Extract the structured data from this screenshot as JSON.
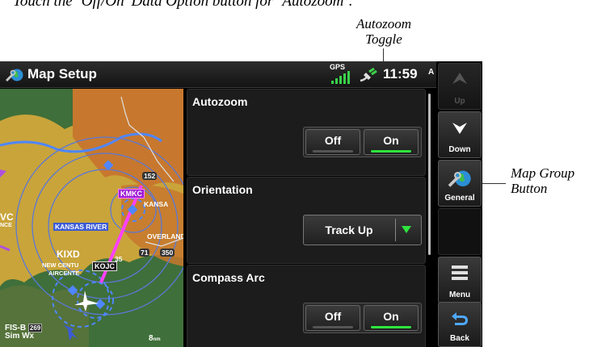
{
  "document": {
    "instruction": "Touch the ‘Off/On’ Data Option button for ‘Autozoom’.",
    "callouts": {
      "autozoom_toggle": [
        "Autozoom",
        "Toggle"
      ],
      "map_group_button": [
        "Map Group",
        "Button"
      ]
    }
  },
  "window": {
    "title": "Map Setup",
    "title_icon": "map-globe-wrench-icon",
    "gps_label": "GPS",
    "time": "11:59",
    "time_suffix": "A"
  },
  "map": {
    "airports": {
      "kmkc": "KMKC",
      "kixd": "KIXD",
      "kojc": "KOJC"
    },
    "labels": {
      "kansas_city": "KANSA",
      "kansas_river": "KANSAS RIVER",
      "overland": "OVERLAND",
      "new_century": "NEW CENTU",
      "aircenter": "AIRCENTE",
      "partial_vc": "VC",
      "partial_nce": "NCE",
      "hwy_152": "152",
      "hwy_71": "71",
      "hwy_350": "350",
      "hwy_35": "35"
    },
    "fisb_line1": "FIS-B",
    "fisb_count": "269",
    "fisb_line2": "Sim Wx",
    "range": "8",
    "range_unit": "nm",
    "colors": {
      "terrain_yellow": "#c9a43a",
      "terrain_orange": "#c7782e",
      "terrain_green": "#3f6f3a",
      "route_magenta": "#ff40ff",
      "airspace_blue": "#4f86ff"
    }
  },
  "settings": {
    "autozoom": {
      "label": "Autozoom",
      "off": "Off",
      "on": "On",
      "selected": "On"
    },
    "orientation": {
      "label": "Orientation",
      "value": "Track Up"
    },
    "compass_arc": {
      "label": "Compass Arc",
      "off": "Off",
      "on": "On",
      "selected": "On"
    }
  },
  "softkeys": {
    "up": {
      "label": "Up",
      "icon": "up-arrow-icon",
      "enabled": false
    },
    "down": {
      "label": "Down",
      "icon": "down-arrow-icon",
      "enabled": true
    },
    "general": {
      "label": "General",
      "icon": "map-globe-wrench-icon",
      "enabled": true
    },
    "menu": {
      "label": "Menu",
      "icon": "menu-list-icon",
      "enabled": true
    },
    "back": {
      "label": "Back",
      "icon": "back-arrow-icon",
      "enabled": true
    }
  }
}
